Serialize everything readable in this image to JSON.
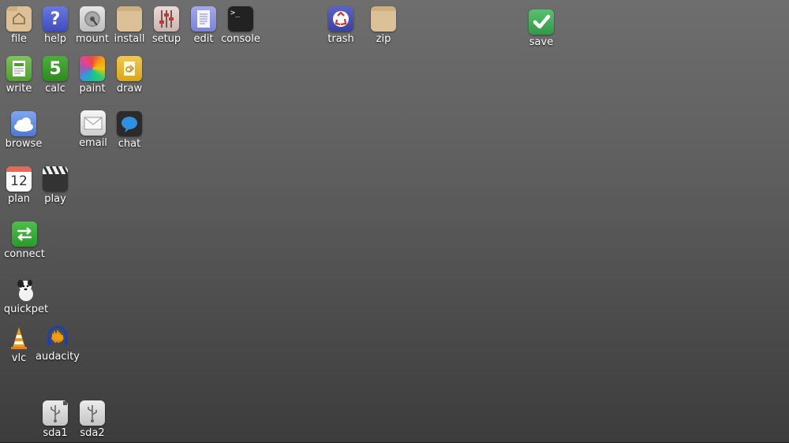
{
  "desktop": {
    "icons": {
      "file": {
        "label": "file",
        "icon": "home-folder-icon"
      },
      "help": {
        "label": "help",
        "icon": "question-mark-icon"
      },
      "mount": {
        "label": "mount",
        "icon": "disk-drive-icon"
      },
      "install": {
        "label": "install",
        "icon": "package-icon"
      },
      "setup": {
        "label": "setup",
        "icon": "sliders-icon"
      },
      "edit": {
        "label": "edit",
        "icon": "text-document-icon"
      },
      "console": {
        "label": "console",
        "icon": "terminal-icon",
        "glyph": ">_"
      },
      "trash": {
        "label": "trash",
        "icon": "recycle-icon"
      },
      "zip": {
        "label": "zip",
        "icon": "archive-box-icon"
      },
      "save": {
        "label": "save",
        "icon": "checkmark-icon"
      },
      "write": {
        "label": "write",
        "icon": "word-processor-icon"
      },
      "calc": {
        "label": "calc",
        "icon": "spreadsheet-icon",
        "glyph": "5"
      },
      "paint": {
        "label": "paint",
        "icon": "color-wheel-icon"
      },
      "draw": {
        "label": "draw",
        "icon": "drawing-icon"
      },
      "browse": {
        "label": "browse",
        "icon": "cloud-icon"
      },
      "email": {
        "label": "email",
        "icon": "envelope-icon"
      },
      "chat": {
        "label": "chat",
        "icon": "speech-bubble-icon"
      },
      "plan": {
        "label": "plan",
        "icon": "calendar-icon",
        "glyph": "12"
      },
      "play": {
        "label": "play",
        "icon": "clapperboard-icon"
      },
      "connect": {
        "label": "connect",
        "icon": "network-arrows-icon"
      },
      "quickpet": {
        "label": "quickpet",
        "icon": "puppy-icon"
      },
      "vlc": {
        "label": "vlc",
        "icon": "traffic-cone-icon"
      },
      "audacity": {
        "label": "audacity",
        "icon": "headphones-waveform-icon"
      },
      "sda1": {
        "label": "sda1",
        "icon": "usb-drive-icon"
      },
      "sda2": {
        "label": "sda2",
        "icon": "usb-drive-icon"
      }
    }
  }
}
